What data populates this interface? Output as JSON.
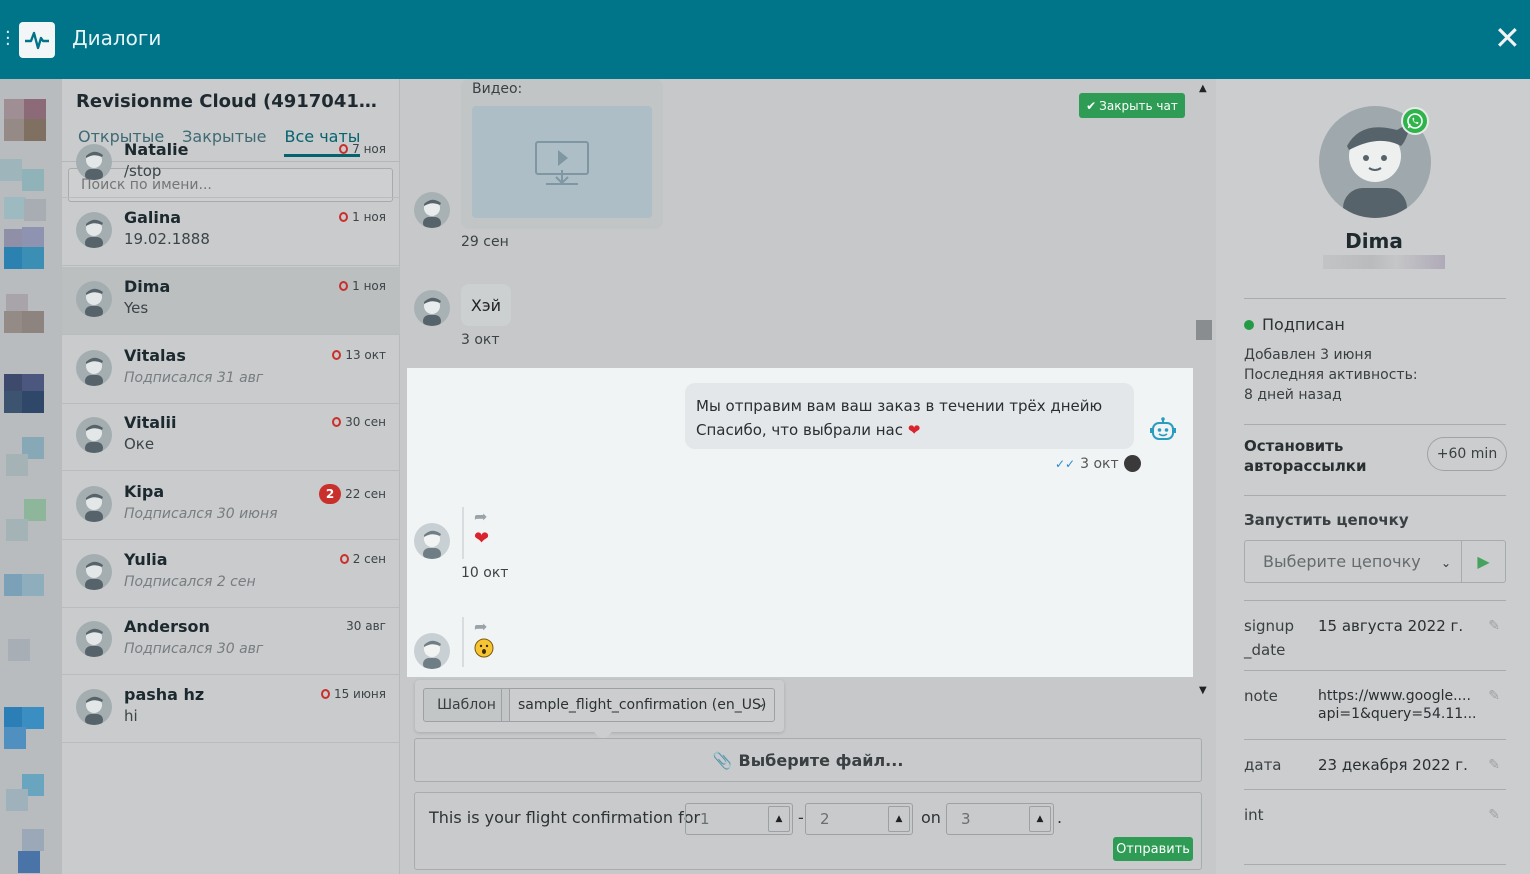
{
  "header": {
    "title": "Диалоги",
    "close_glyph": "✕"
  },
  "account": {
    "name": "Revisionme Cloud (4917041510..."
  },
  "tabs": [
    {
      "label": "Открытые",
      "active": false
    },
    {
      "label": "Закрытые",
      "active": false
    },
    {
      "label": "Все чаты",
      "active": true
    }
  ],
  "search": {
    "placeholder": "Поиск по имени..."
  },
  "chats": [
    {
      "name": "Natalie",
      "preview": "/stop",
      "date": "7 ноя",
      "indicator": "ring",
      "preview_style": "normal"
    },
    {
      "name": "Galina",
      "preview": "19.02.1888",
      "date": "1 ноя",
      "indicator": "ring",
      "preview_style": "normal"
    },
    {
      "name": "Dima",
      "preview": "Yes",
      "date": "1 ноя",
      "indicator": "ring",
      "preview_style": "normal",
      "selected": true
    },
    {
      "name": "Vitalas",
      "preview": "Подписался 31 авг",
      "date": "13 окт",
      "indicator": "ring",
      "preview_style": "gray"
    },
    {
      "name": "Vitalii",
      "preview": "Оке",
      "date": "30 сен",
      "indicator": "ring",
      "preview_style": "normal"
    },
    {
      "name": "Kipa",
      "preview": "Подписался 30 июня",
      "date": "22 сен",
      "indicator": "badge",
      "badge": "2",
      "preview_style": "gray"
    },
    {
      "name": "Yulia",
      "preview": "Подписался 2 сен",
      "date": "2 сен",
      "indicator": "ring",
      "preview_style": "gray"
    },
    {
      "name": "Anderson",
      "preview": "Подписался 30 авг",
      "date": "30 авг",
      "indicator": "none",
      "preview_style": "gray"
    },
    {
      "name": "pasha hz",
      "preview": "hi",
      "date": "15 июня",
      "indicator": "ring",
      "preview_style": "normal"
    }
  ],
  "conversation": {
    "close_chat_label": "Закрыть чат",
    "video_label": "Видео:",
    "video_date": "29 сен",
    "hey_text": "Хэй",
    "hey_date": "3 окт",
    "outgoing_line1": "Мы отправим вам ваш заказ в течении трёх днейю",
    "outgoing_line2": "Спасибо, что выбрали нас",
    "outgoing_date": "3 окт",
    "reaction1_date": "10 окт"
  },
  "compose": {
    "template_label": "Шаблон",
    "template_value": "sample_flight_confirmation (en_US)",
    "file_button": "Выберите файл...",
    "text_before": "This is your flight confirmation for",
    "param1": "1",
    "dash": "-",
    "param2": "2",
    "on": "on",
    "param3": "3",
    "period": ".",
    "send_label": "Отправить"
  },
  "profile": {
    "name": "Dima",
    "status": "Подписан",
    "added": "Добавлен 3 июня",
    "last_activity_label": "Последняя активность:",
    "last_activity_value": "8 дней назад",
    "stop_autosend": "Остановить авторассылки",
    "plus60": "+60 min",
    "run_chain_label": "Запустить цепочку",
    "chain_placeholder": "Выберите цепочку",
    "fields": [
      {
        "key": "signup _date",
        "value": "15 августа 2022 г."
      },
      {
        "key": "note",
        "value": "https://www.google.... api=1&query=54.11..."
      },
      {
        "key": "дата",
        "value": "23 декабря 2022 г."
      },
      {
        "key": "int",
        "value": ""
      }
    ]
  },
  "colors": {
    "header_bg": "#007489",
    "accent_green": "#2e9c55",
    "badge_red": "#c9302c",
    "whatsapp_green": "#2fb44b"
  }
}
